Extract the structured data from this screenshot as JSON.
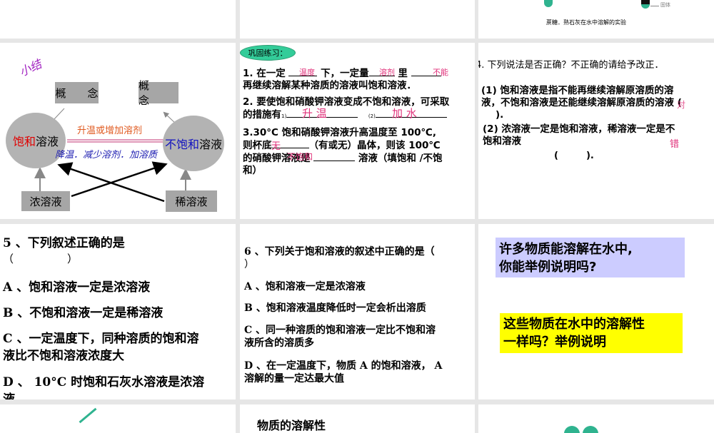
{
  "slide_top_right": {
    "caption": "蔗糖．熟石灰在水中溶解的实验",
    "label_solid": "固体"
  },
  "slide_summary": {
    "title": "小结",
    "concept_left": "概　　念",
    "concept_right": "概　　念",
    "saturated_red": "饱和",
    "saturated_black": "溶液",
    "unsaturated_blue": "不饱和",
    "unsaturated_black": "溶液",
    "arrow_top_label": "升温或增加溶剂",
    "arrow_bottom_label": "降温．减少溶剂．加溶质",
    "concentrated": "浓溶液",
    "dilute": "稀溶液"
  },
  "slide_practice": {
    "badge": "巩固练习：",
    "q1_a": "1. 在一定",
    "q1_b": "下，一定量",
    "q1_c": "里",
    "q1_d": "再继续溶解某种溶质的溶液叫饱和溶液．",
    "q1_ans1": "温度",
    "q1_ans2": "溶剂",
    "q1_ans3": "不能",
    "q2_a": "2. 要使饱和硝酸钾溶液变成不饱和溶液，可采取",
    "q2_b": "的措施有",
    "q2_n1": "1)",
    "q2_n2": "(2)",
    "q2_ans1": "升 温",
    "q2_ans2": "加 水",
    "q3_a": "3.30°C 饱和硝酸钾溶液升高温度至 100℃,",
    "q3_b1": "则杯底",
    "q3_b2": "（有或无）晶体，则该 100℃",
    "q3_c1": "的硝酸钾溶液是",
    "q3_c2": "溶液（填饱和 /不饱",
    "q3_d": "和）",
    "q3_ans1": "无",
    "q3_ans2": "不饱和"
  },
  "slide_q4": {
    "title": "4. 下列说法是否正确？不正确的请给予改正．",
    "p1_a": "(1) 饱和溶液是指不能再继续溶解原溶质的溶",
    "p1_b": "液，不饱和溶液是还能继续溶解原溶质的溶液 (",
    "p1_c": ").",
    "p1_ans": "对",
    "p2_a": "(2) 浓溶液一定是饱和溶液，稀溶液一定是不",
    "p2_b": "饱和溶液",
    "p2_c": "(　　　).",
    "p2_ans": "错"
  },
  "slide_q5": {
    "title": "5 、下列叙述正确的是",
    "paren": "（　　　　　）",
    "a": "A 、饱和溶液一定是浓溶液",
    "b": "B 、不饱和溶液一定是稀溶液",
    "c1": "C 、一定温度下，同种溶质的饱和溶",
    "c2": "液比不饱和溶液浓度大",
    "d1": "D 、 10°C 时饱和石灰水溶液是浓溶",
    "d2": "液"
  },
  "slide_q6": {
    "title1": "6 、下列关于饱和溶液的叙述中正确的是（",
    "title2": "）",
    "a": "A 、饱和溶液一定是浓溶液",
    "b": "B 、饱和溶液温度降低时一定会析出溶质",
    "c1": "C 、同一种溶质的饱和溶液一定比不饱和溶",
    "c2": "液所含的溶质多",
    "d1": "D 、在一定温度下，物质 A 的饱和溶液， A",
    "d2": "溶解的量一定达最大值"
  },
  "slide_questions": {
    "box1_l1": "许多物质能溶解在水中,",
    "box1_l2": "你能举例说明吗?",
    "box2_l1": "这些物质在水中的溶解性",
    "box2_l2": "一样吗？举例说明"
  },
  "slide_bottom_mid": {
    "title": "物质的溶解性"
  },
  "colors": {
    "gap": "#e6e6e6",
    "pink": "#e0307a",
    "lavender": "#ccccff",
    "yellow": "#ffff00",
    "teal": "#2fb38f"
  }
}
